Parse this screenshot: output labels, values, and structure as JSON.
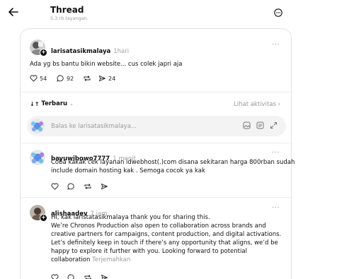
{
  "header": {
    "title": "Thread",
    "subtitle": "5,3 rb tayangan"
  },
  "post": {
    "username": "larisatasikmalaya",
    "time": "1hari",
    "text": "Ada yg bs bantu bikin website... cus colek japri aja",
    "likes": "54",
    "comments": "92",
    "shares": "24",
    "more": "···"
  },
  "sort": {
    "label": "Terbaru",
    "activity": "Lihat aktivitas"
  },
  "reply_box": {
    "placeholder": "Balas ke larisatasikmalaya..."
  },
  "replies": [
    {
      "username": "bayuwibowo7777",
      "time": "1 menit",
      "lines": [
        "Coba kakak cek layanan idwebhost(.)com disana sekitaran harga 800rban sudah",
        "include domain hosting kak . Semoga cocok ya kak"
      ],
      "more": "···"
    },
    {
      "username": "alishaadev",
      "time": "7 jam",
      "lines": [
        "Hi, kak laristatasikmalaya thank you for sharing this.",
        "We’re Chronos Production also open to collaboration across brands and",
        "creative partners for campaigns, content production, and digital activations.",
        "Let’s definitely keep in touch if there’s any opportunity that aligns, we’d be",
        "happy to explore it further with you. Looking forward to potential",
        "collaboration"
      ],
      "translate": "Terjemahkan",
      "more": "···"
    }
  ]
}
